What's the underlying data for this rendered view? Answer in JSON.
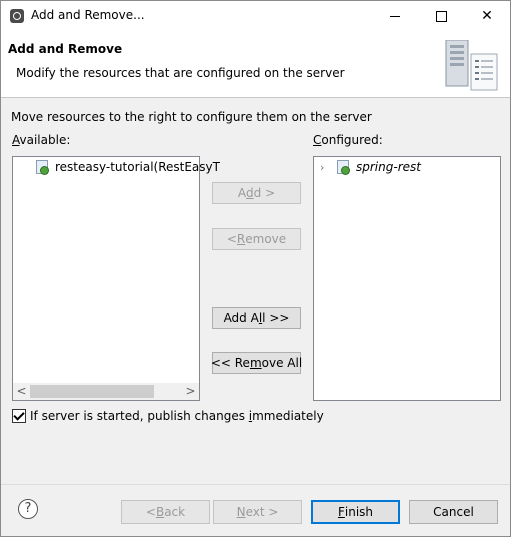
{
  "window": {
    "title": "Add and Remove...",
    "min_icon": "minimize-icon",
    "max_icon": "maximize-icon",
    "close_icon": "close-icon",
    "close_glyph": "✕"
  },
  "banner": {
    "title": "Add and Remove",
    "description": "Modify the resources that are configured on the server",
    "icon": "server-icon"
  },
  "instruction": "Move resources to the right to configure them on the server",
  "available": {
    "label_mnemonic": "A",
    "label_rest": "vailable:",
    "items": [
      {
        "label": "resteasy-tutorial(RestEasyT",
        "icon": "web-project-icon"
      }
    ]
  },
  "configured": {
    "label_mnemonic": "C",
    "label_rest": "onfigured:",
    "items": [
      {
        "label": "spring-rest",
        "icon": "web-project-icon",
        "expander": "›"
      }
    ]
  },
  "buttons": {
    "add": {
      "pre": "A",
      "mn": "d",
      "post": "d >"
    },
    "remove": {
      "pre": "< ",
      "mn": "R",
      "post": "emove"
    },
    "add_all": {
      "pre": "Add A",
      "mn": "l",
      "post": "l >>"
    },
    "remove_all": {
      "pre": "<< Re",
      "mn": "m",
      "post": "ove All"
    },
    "back": {
      "pre": "< ",
      "mn": "B",
      "post": "ack"
    },
    "next": {
      "pre": "",
      "mn": "N",
      "post": "ext >"
    },
    "finish": {
      "pre": "",
      "mn": "F",
      "post": "inish"
    },
    "cancel": "Cancel"
  },
  "publish_checkbox": {
    "checked": true,
    "label_pre": "If server is started, publish changes ",
    "label_mn": "i",
    "label_post": "mmediately"
  },
  "help": {
    "glyph": "?",
    "icon": "help-icon"
  },
  "scroll": {
    "left_glyph": "<",
    "right_glyph": ">"
  },
  "colors": {
    "accent": "#0078d7",
    "project_dot": "#4fa33c"
  }
}
